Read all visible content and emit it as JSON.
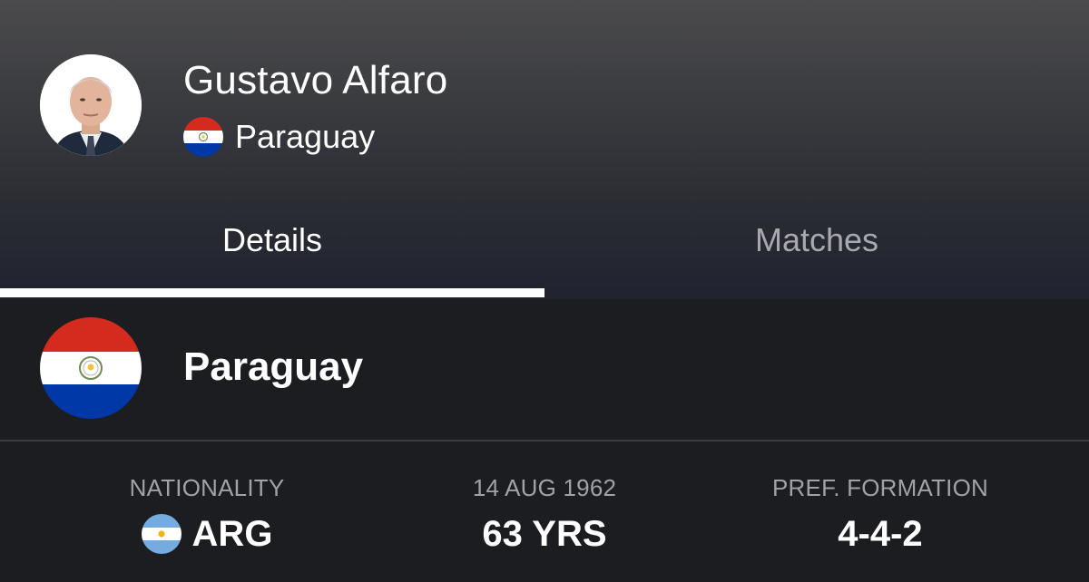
{
  "coach": {
    "name": "Gustavo Alfaro",
    "team": "Paraguay"
  },
  "tabs": [
    {
      "label": "Details",
      "active": true
    },
    {
      "label": "Matches",
      "active": false
    }
  ],
  "team_section": {
    "name": "Paraguay",
    "flag": "paraguay-flag"
  },
  "stats": [
    {
      "label": "NATIONALITY",
      "value": "ARG",
      "icon": "argentina-flag"
    },
    {
      "label": "14 AUG 1962",
      "value": "63 YRS"
    },
    {
      "label": "PREF. FORMATION",
      "value": "4-4-2"
    }
  ],
  "colors": {
    "background": "#1b1d20",
    "active_tab": "#ffffff",
    "inactive_tab": "#a8a9ad",
    "label_gray": "#a0a2a6",
    "paraguay_red": "#d52b1e",
    "paraguay_blue": "#0038a8",
    "argentina_blue": "#74acdf"
  }
}
